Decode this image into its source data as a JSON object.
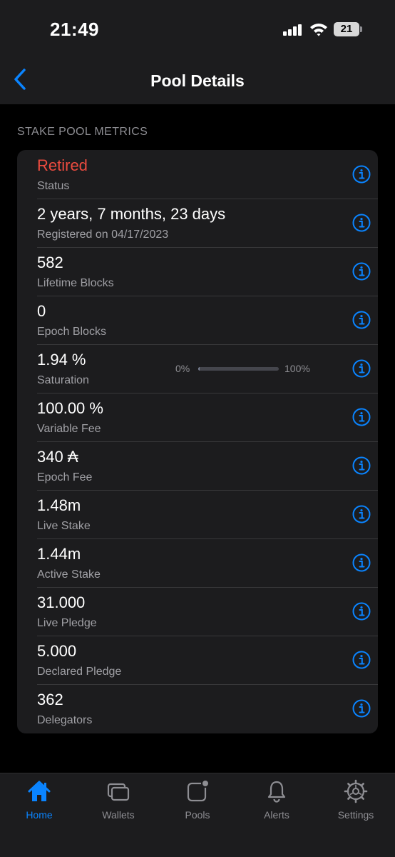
{
  "status_bar": {
    "time": "21:49",
    "battery": "21"
  },
  "nav": {
    "title": "Pool Details"
  },
  "section": {
    "header": "STAKE POOL METRICS"
  },
  "metrics": [
    {
      "value": "Retired",
      "label": "Status"
    },
    {
      "value": "2 years, 7 months, 23 days",
      "label": "Registered on 04/17/2023"
    },
    {
      "value": "582",
      "label": "Lifetime Blocks"
    },
    {
      "value": "0",
      "label": "Epoch Blocks"
    },
    {
      "value": "1.94 %",
      "label": "Saturation"
    },
    {
      "value": "100.00 %",
      "label": "Variable Fee"
    },
    {
      "value": "340 ₳",
      "label": "Epoch Fee"
    },
    {
      "value": "1.48m",
      "label": "Live Stake"
    },
    {
      "value": "1.44m",
      "label": "Active Stake"
    },
    {
      "value": "31.000",
      "label": "Live Pledge"
    },
    {
      "value": "5.000",
      "label": "Declared Pledge"
    },
    {
      "value": "362",
      "label": "Delegators"
    }
  ],
  "saturation_bar": {
    "min_label": "0%",
    "max_label": "100%",
    "fill_percent": 1.94
  },
  "tabs": [
    {
      "label": "Home",
      "icon": "house-icon",
      "active": true
    },
    {
      "label": "Wallets",
      "icon": "wallets-icon",
      "active": false
    },
    {
      "label": "Pools",
      "icon": "pools-icon",
      "active": false
    },
    {
      "label": "Alerts",
      "icon": "bell-icon",
      "active": false
    },
    {
      "label": "Settings",
      "icon": "gear-icon",
      "active": false
    }
  ],
  "colors": {
    "accent": "#0a84ff",
    "retired": "#eb4b3f",
    "background": "#000000",
    "card": "#1c1c1e"
  }
}
